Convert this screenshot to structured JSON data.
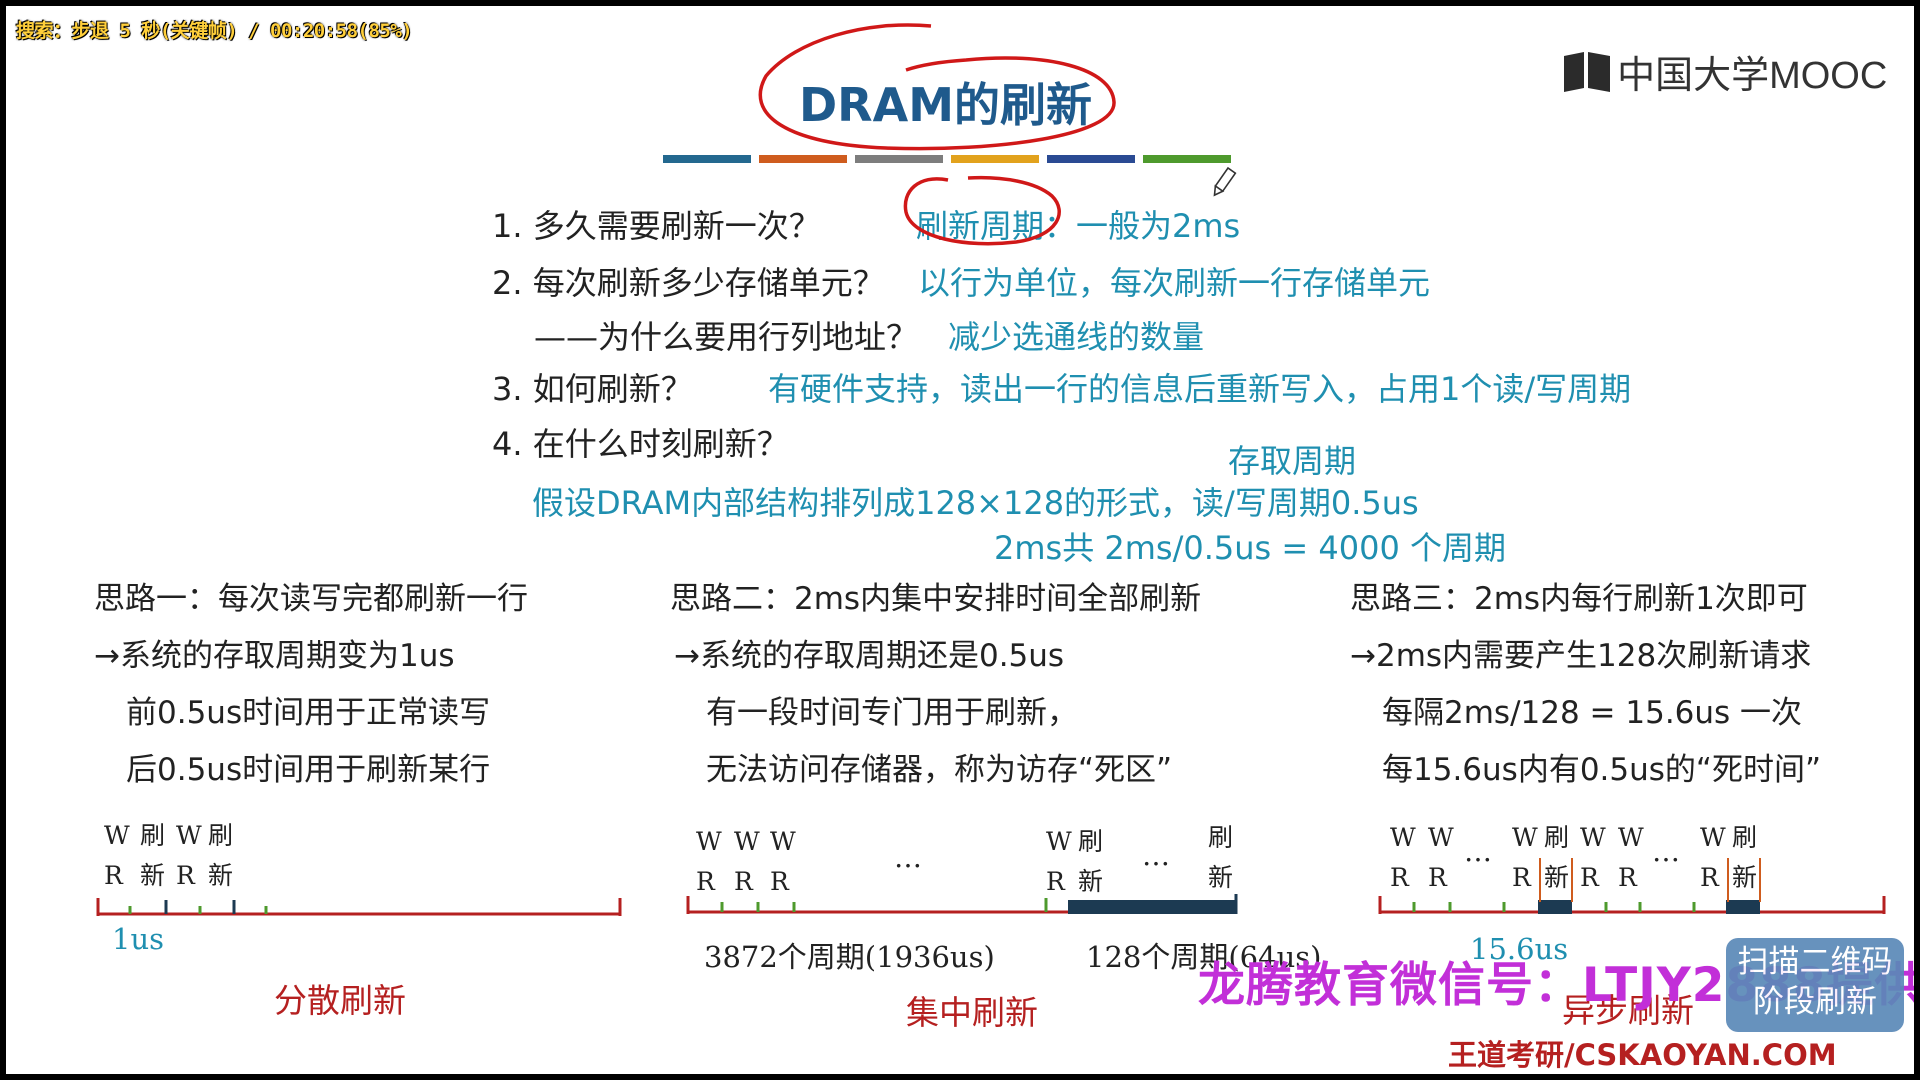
{
  "osd": "搜索：步退 5 秒(关键帧) / 00:20:58(85%)",
  "logo": {
    "text": "中国大学MOOC"
  },
  "title": "DRAM的刷新",
  "colors": {
    "q": "#222222",
    "answer": "#1f8fb0",
    "title": "#1f5a8c",
    "bar_red": "#b52020",
    "watermark": "#c22fd8"
  },
  "q1": {
    "q": "1. 多久需要刷新一次？",
    "a": "刷新周期：一般为2ms"
  },
  "q2": {
    "q": "2. 每次刷新多少存储单元？",
    "a": "以行为单位，每次刷新一行存储单元"
  },
  "q2b": {
    "q": "——为什么要用行列地址？",
    "a": "减少选通线的数量"
  },
  "q3": {
    "q": "3. 如何刷新？",
    "a": "有硬件支持，读出一行的信息后重新写入，占用1个读/写周期"
  },
  "q4": {
    "q": "4. 在什么时刻刷新？"
  },
  "assume": {
    "line1": "假设DRAM内部结构排列成128×128的形式，读/写周期0.5us",
    "cycle_label": "存取周期",
    "line2": "2ms共 2ms/0.5us = 4000 个周期"
  },
  "ideas": [
    {
      "title": "思路一：每次读写完都刷新一行",
      "l1": "→系统的存取周期变为1us",
      "l2": "前0.5us时间用于正常读写",
      "l3": "后0.5us时间用于刷新某行"
    },
    {
      "title": "思路二：2ms内集中安排时间全部刷新",
      "l1": "→系统的存取周期还是0.5us",
      "l2": "有一段时间专门用于刷新，",
      "l3": "无法访问存储器，称为访存“死区”"
    },
    {
      "title": "思路三：2ms内每行刷新1次即可",
      "l1": "→2ms内需要产生128次刷新请求",
      "l2": "每隔2ms/128 = 15.6us 一次",
      "l3": "每15.6us内有0.5us的“死时间”"
    }
  ],
  "timeline_labels": {
    "w": "W",
    "r": "R",
    "shua": "刷",
    "xin": "新",
    "dots": "…"
  },
  "timeline1": {
    "unit": "1us",
    "caption": "分散刷新"
  },
  "timeline2": {
    "left": "3872个周期(1936us)",
    "right": "128个周期(64us)",
    "caption": "集中刷新"
  },
  "timeline3": {
    "unit": "15.6us",
    "caption": "异步刷新"
  },
  "watermark": "龙腾教育微信号：LTJY2888提供",
  "qr_tag": {
    "l1": "扫描二维码",
    "l2": "阶段刷新"
  },
  "site": "王道考研/CSKAOYAN.COM"
}
